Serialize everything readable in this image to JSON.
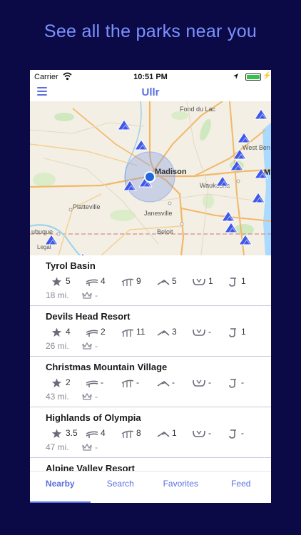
{
  "headline": "See all the parks near you",
  "status_bar": {
    "carrier": "Carrier",
    "time": "10:51 PM"
  },
  "nav": {
    "title": "Ullr",
    "menu_icon": "hamburger-menu-icon"
  },
  "map": {
    "places": {
      "fond_du_lac": "Fond du Lac",
      "west_bend": "West Ben",
      "madison": "Madison",
      "waukesha": "Waukesha",
      "platteville": "Platteville",
      "janesville": "Janesville",
      "beloit": "Beloit",
      "dubuque": "ubuque",
      "legal": "Legal",
      "milwaukee_fragment": "M"
    },
    "marker_icon": "park-triangle-icon",
    "location_icon": "current-location-dot"
  },
  "colors": {
    "background": "#0b0a47",
    "accent": "#5a6fe0",
    "headline": "#7b93ff",
    "marker": "#3f58e8"
  },
  "stat_icons": [
    "star-icon",
    "lift-icon",
    "terrain-park-icon",
    "trail-icon",
    "halfpipe-icon",
    "rail-icon"
  ],
  "meta_icons": [
    "crown-icon"
  ],
  "parks": [
    {
      "name": "Tyrol Basin",
      "rating": "5",
      "lifts": "4",
      "parks": "9",
      "trails": "5",
      "halfpipes": "1",
      "rails": "1",
      "distance": "18 mi.",
      "vertical": "-"
    },
    {
      "name": "Devils Head Resort",
      "rating": "4",
      "lifts": "2",
      "parks": "11",
      "trails": "3",
      "halfpipes": "-",
      "rails": "1",
      "distance": "26 mi.",
      "vertical": "-"
    },
    {
      "name": "Christmas Mountain Village",
      "rating": "2",
      "lifts": "-",
      "parks": "-",
      "trails": "-",
      "halfpipes": "-",
      "rails": "-",
      "distance": "43 mi.",
      "vertical": "-"
    },
    {
      "name": "Highlands of Olympia",
      "rating": "3.5",
      "lifts": "4",
      "parks": "8",
      "trails": "1",
      "halfpipes": "-",
      "rails": "-",
      "distance": "47 mi.",
      "vertical": "-"
    },
    {
      "name": "Alpine Valley Resort",
      "rating": "",
      "lifts": "",
      "parks": "",
      "trails": "",
      "halfpipes": "",
      "rails": "",
      "distance": "",
      "vertical": ""
    }
  ],
  "tabs": [
    {
      "label": "Nearby",
      "active": true
    },
    {
      "label": "Search",
      "active": false
    },
    {
      "label": "Favorites",
      "active": false
    },
    {
      "label": "Feed",
      "active": false
    }
  ]
}
